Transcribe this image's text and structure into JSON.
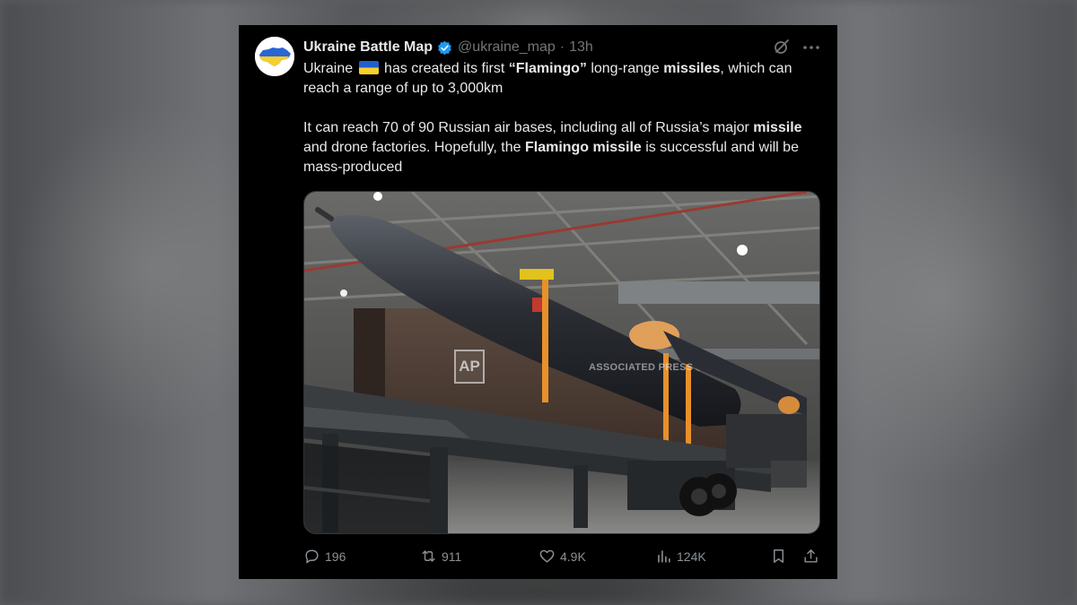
{
  "post": {
    "author": {
      "display_name": "Ukraine Battle Map",
      "handle": "@ukraine_map",
      "time": "13h",
      "verified": true
    },
    "text": {
      "p1": {
        "t1": "Ukraine",
        "flag_icon": "ukraine-flag-emoji",
        "t2": " has created its first ",
        "b1": "“Flamingo”",
        "t3": " long-range ",
        "b2": "missiles",
        "t4": ", which can reach a range of up to 3,000km"
      },
      "p2": {
        "t1": "It can reach 70 of 90 Russian air bases, including all of Russia’s major ",
        "b1": "missile",
        "t2": " and drone factories. Hopefully, the ",
        "b2": "Flamingo missile",
        "t3": " is successful and will be mass-produced"
      }
    },
    "media": {
      "watermark_logo": "AP",
      "watermark_text": "ASSOCIATED PRESS"
    },
    "stats": {
      "replies": "196",
      "reposts": "911",
      "likes": "4.9K",
      "views": "124K"
    },
    "icons": [
      "reply-icon",
      "repost-icon",
      "like-icon",
      "views-icon",
      "bookmark-icon",
      "share-icon",
      "grok-icon",
      "more-icon",
      "verified-badge-icon"
    ],
    "colors": {
      "background": "#000000",
      "text": "#e7e9ea",
      "muted": "#71767b",
      "verified": "#1d9bf0",
      "flag_blue": "#1f5fd0",
      "flag_yellow": "#f8cf2a"
    }
  }
}
